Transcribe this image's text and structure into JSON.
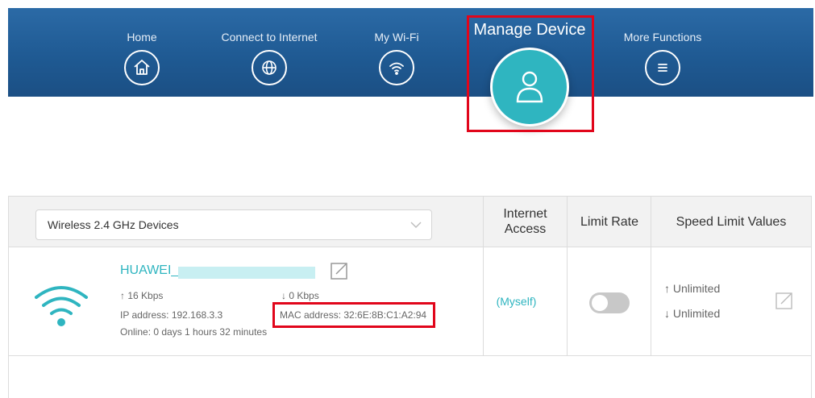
{
  "nav": {
    "items": [
      {
        "label": "Home",
        "icon": "home-icon"
      },
      {
        "label": "Connect to Internet",
        "icon": "globe-icon"
      },
      {
        "label": "My Wi-Fi",
        "icon": "wifi-icon"
      },
      {
        "label": "More Functions",
        "icon": "menu-icon"
      }
    ],
    "active": {
      "label": "Manage Device",
      "icon": "user-icon"
    }
  },
  "device_filter": {
    "selected": "Wireless 2.4 GHz Devices"
  },
  "table": {
    "headers": {
      "internet_access": "Internet Access",
      "limit_rate": "Limit Rate",
      "speed_limit_values": "Speed Limit Values"
    }
  },
  "device": {
    "name": "HUAWEI_",
    "upload_speed": "16 Kbps",
    "download_speed": "0 Kbps",
    "ip_address": "IP address: 192.168.3.3",
    "mac_address": "MAC address: 32:6E:8B:C1:A2:94",
    "online_time": "Online: 0 days 1 hours 32 minutes",
    "internet_access": "(Myself)",
    "limit_rate_enabled": false,
    "upload_limit": "Unlimited",
    "download_limit": "Unlimited"
  },
  "colors": {
    "accent": "#2fb5c0",
    "nav": "#1f5a93",
    "highlight": "#e1061b"
  }
}
